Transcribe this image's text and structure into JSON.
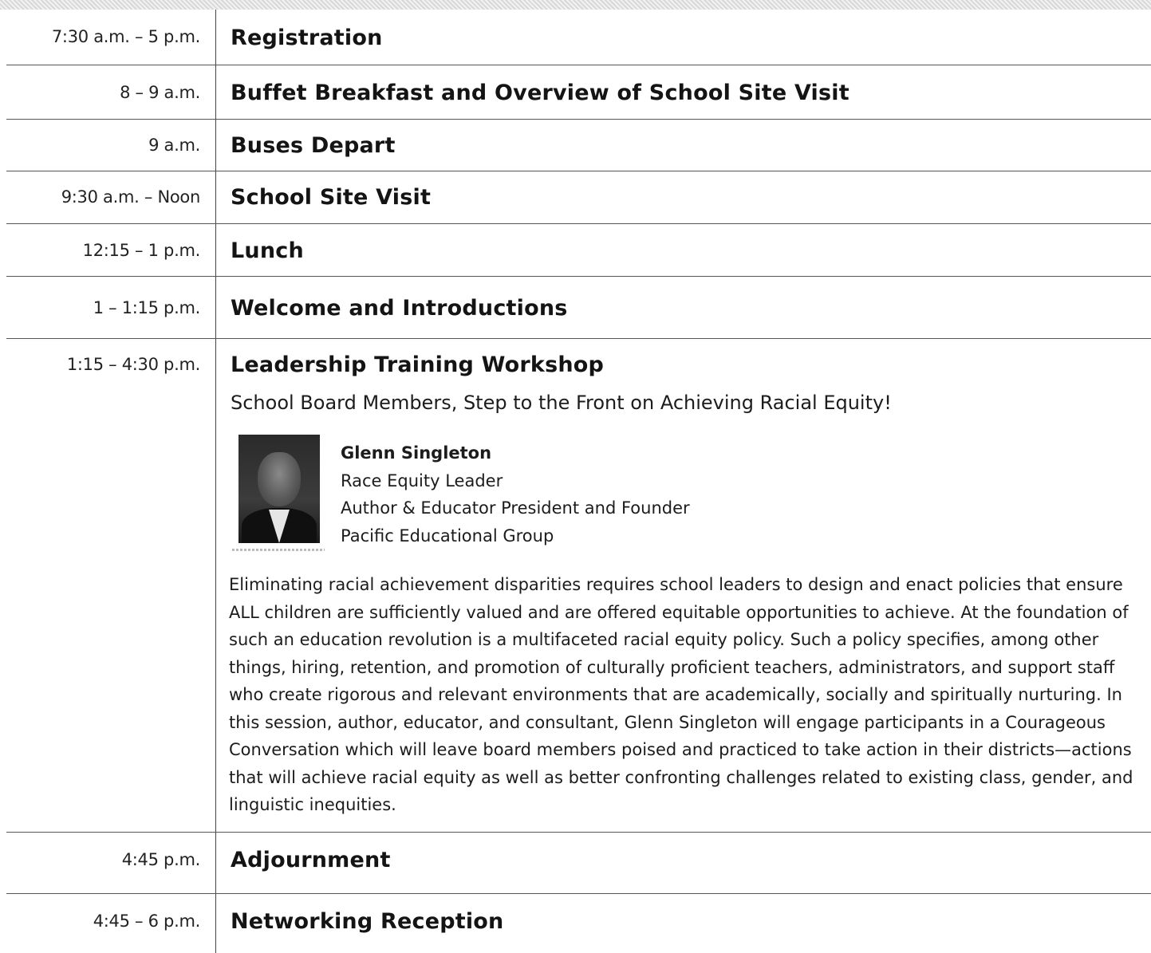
{
  "agenda": [
    {
      "time": "7:30 a.m. – 5 p.m.",
      "title": "Registration"
    },
    {
      "time": "8 – 9 a.m.",
      "title": "Buffet Breakfast and Overview of School Site Visit"
    },
    {
      "time": "9 a.m.",
      "title": "Buses Depart"
    },
    {
      "time": "9:30 a.m. – Noon",
      "title": "School Site Visit"
    },
    {
      "time": "12:15 – 1 p.m.",
      "title": "Lunch"
    },
    {
      "time": "1 – 1:15 p.m.",
      "title": "Welcome and Introductions"
    },
    {
      "time": "1:15 – 4:30 p.m.",
      "title": "Leadership Training Workshop"
    },
    {
      "time": "4:45 p.m.",
      "title": "Adjournment"
    },
    {
      "time": "4:45 – 6 p.m.",
      "title": "Networking Reception"
    }
  ],
  "workshop": {
    "subtitle": "School Board Members, Step to the Front on Achieving Racial Equity!",
    "speaker": {
      "name": "Glenn Singleton",
      "role": "Race Equity Leader",
      "title": "Author & Educator President and Founder",
      "organization": "Pacific Educational Group"
    },
    "description": "Eliminating racial achievement disparities requires school leaders to design and enact policies that ensure ALL children are sufficiently valued and are offered equitable opportunities to achieve. At the foundation of such an education revolution is a multifaceted racial equity policy. Such a policy specifies, among other things, hiring, retention, and promotion of culturally proficient teachers, administrators, and support staff who create rigorous and relevant environments that are academically, socially and spiritually nurturing. In this session, author, educator, and consultant, Glenn Singleton will engage participants in a Courageous Conversation which will leave board members poised and practiced to take action in their districts—actions that will achieve racial equity as well as better confronting challenges related to existing class, gender, and linguistic inequities."
  }
}
